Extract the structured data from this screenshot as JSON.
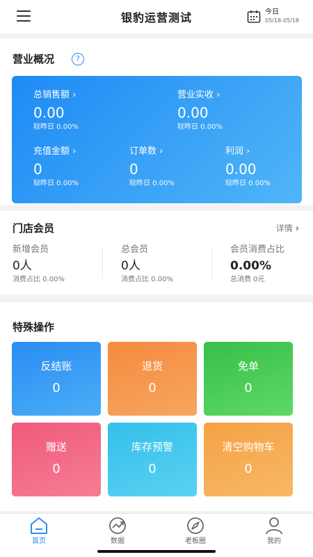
{
  "header": {
    "title": "银豹运营测试",
    "date_label": "今日",
    "date_range": "05/18-05/18"
  },
  "overview": {
    "title": "营业概况",
    "help": "?",
    "metrics": [
      {
        "label": "总销售额 ›",
        "value": "0.00",
        "compare": "较昨日 0.00%"
      },
      {
        "label": "营业实收 ›",
        "value": "0.00",
        "compare": "较昨日 0.00%"
      },
      {
        "label": "充值金额 ›",
        "value": "0",
        "compare": "较昨日 0.00%"
      },
      {
        "label": "订单数 ›",
        "value": "0",
        "compare": "较昨日 0.00%"
      },
      {
        "label": "利润 ›",
        "value": "0.00",
        "compare": "较昨日 0.00%"
      }
    ]
  },
  "members": {
    "title": "门店会员",
    "detail": "详情",
    "detail_arrow": "›",
    "cols": [
      {
        "label": "新增会员",
        "value": "0人",
        "sub": "消费占比 0.00%"
      },
      {
        "label": "总会员",
        "value": "0人",
        "sub": "消费占比 0.00%"
      },
      {
        "label": "会员消费占比",
        "value": "0.00%",
        "sub": "总消费 0元"
      }
    ]
  },
  "ops": {
    "title": "特殊操作",
    "tiles": [
      {
        "label": "反结账",
        "value": "0"
      },
      {
        "label": "退货",
        "value": "0"
      },
      {
        "label": "免单",
        "value": "0"
      },
      {
        "label": "赠送",
        "value": "0"
      },
      {
        "label": "库存预警",
        "value": "0"
      },
      {
        "label": "清空购物车",
        "value": "0"
      }
    ]
  },
  "tabs": [
    {
      "label": "首页",
      "icon": "home-icon",
      "active": true
    },
    {
      "label": "数据",
      "icon": "data-trend-icon",
      "active": false
    },
    {
      "label": "老板圈",
      "icon": "compass-icon",
      "active": false
    },
    {
      "label": "我的",
      "icon": "user-icon",
      "active": false
    }
  ],
  "colors": {
    "accent": "#2f8cf0",
    "card_blue": "#1e8af5"
  }
}
